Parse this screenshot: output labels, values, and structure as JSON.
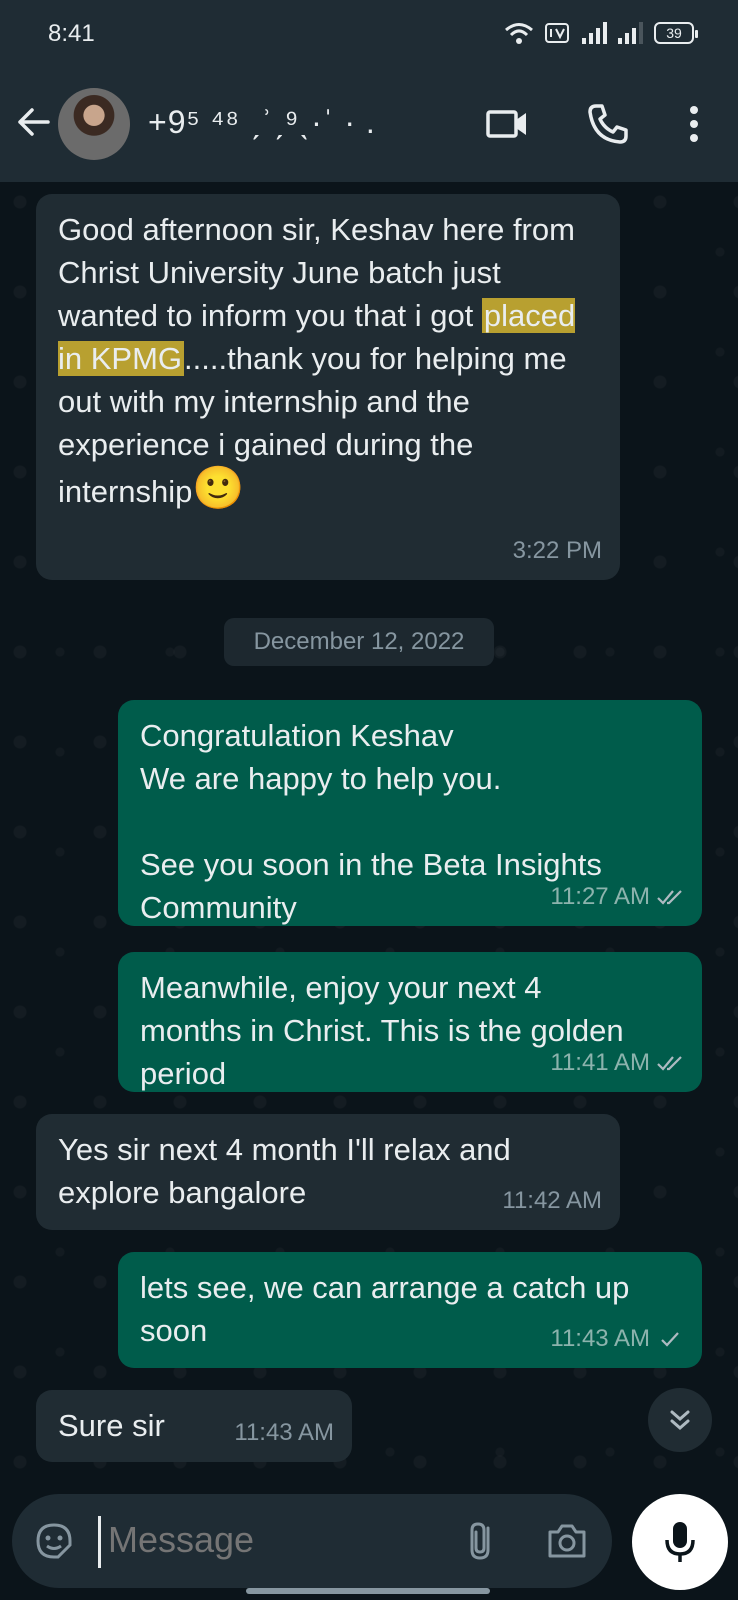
{
  "status_bar": {
    "time": "8:41",
    "battery": "39"
  },
  "header": {
    "contact_name": "+9⁵ ⁴⁸ ˏʾˏ⁹ˎ·ˈ · .",
    "icons": [
      "back-arrow-icon",
      "video-call-icon",
      "voice-call-icon",
      "more-options-icon"
    ]
  },
  "messages": [
    {
      "direction": "incoming",
      "text_before": "Good afternoon sir, Keshav here from Christ University June batch just wanted to inform you that i got ",
      "highlight": "placed in KPMG",
      "text_after": ".....thank you for helping me out with my internship and the experience i gained during the internship",
      "emoji": "🙂",
      "time": "3:22 PM"
    },
    {
      "direction": "outgoing",
      "text": "Congratulation Keshav\nWe are happy to help you.\n\nSee you soon in the Beta Insights Community",
      "time": "11:27 AM",
      "status": "read"
    },
    {
      "direction": "outgoing",
      "text": "Meanwhile, enjoy your next 4 months in Christ. This is the golden period",
      "time": "11:41 AM",
      "status": "read"
    },
    {
      "direction": "incoming",
      "text": "Yes sir next 4 month I'll relax and explore bangalore",
      "time": "11:42 AM"
    },
    {
      "direction": "outgoing",
      "text": "lets see, we can arrange a catch up soon",
      "time": "11:43 AM",
      "status": "sent"
    },
    {
      "direction": "incoming",
      "text": "Sure sir",
      "time": "11:43 AM"
    }
  ],
  "date_divider": "December 12, 2022",
  "composer": {
    "placeholder": "Message"
  },
  "colors": {
    "background": "#0b141a",
    "header": "#1f2c34",
    "incoming_bubble": "#202c33",
    "outgoing_bubble": "#005c4b",
    "highlight": "#b8a030"
  }
}
